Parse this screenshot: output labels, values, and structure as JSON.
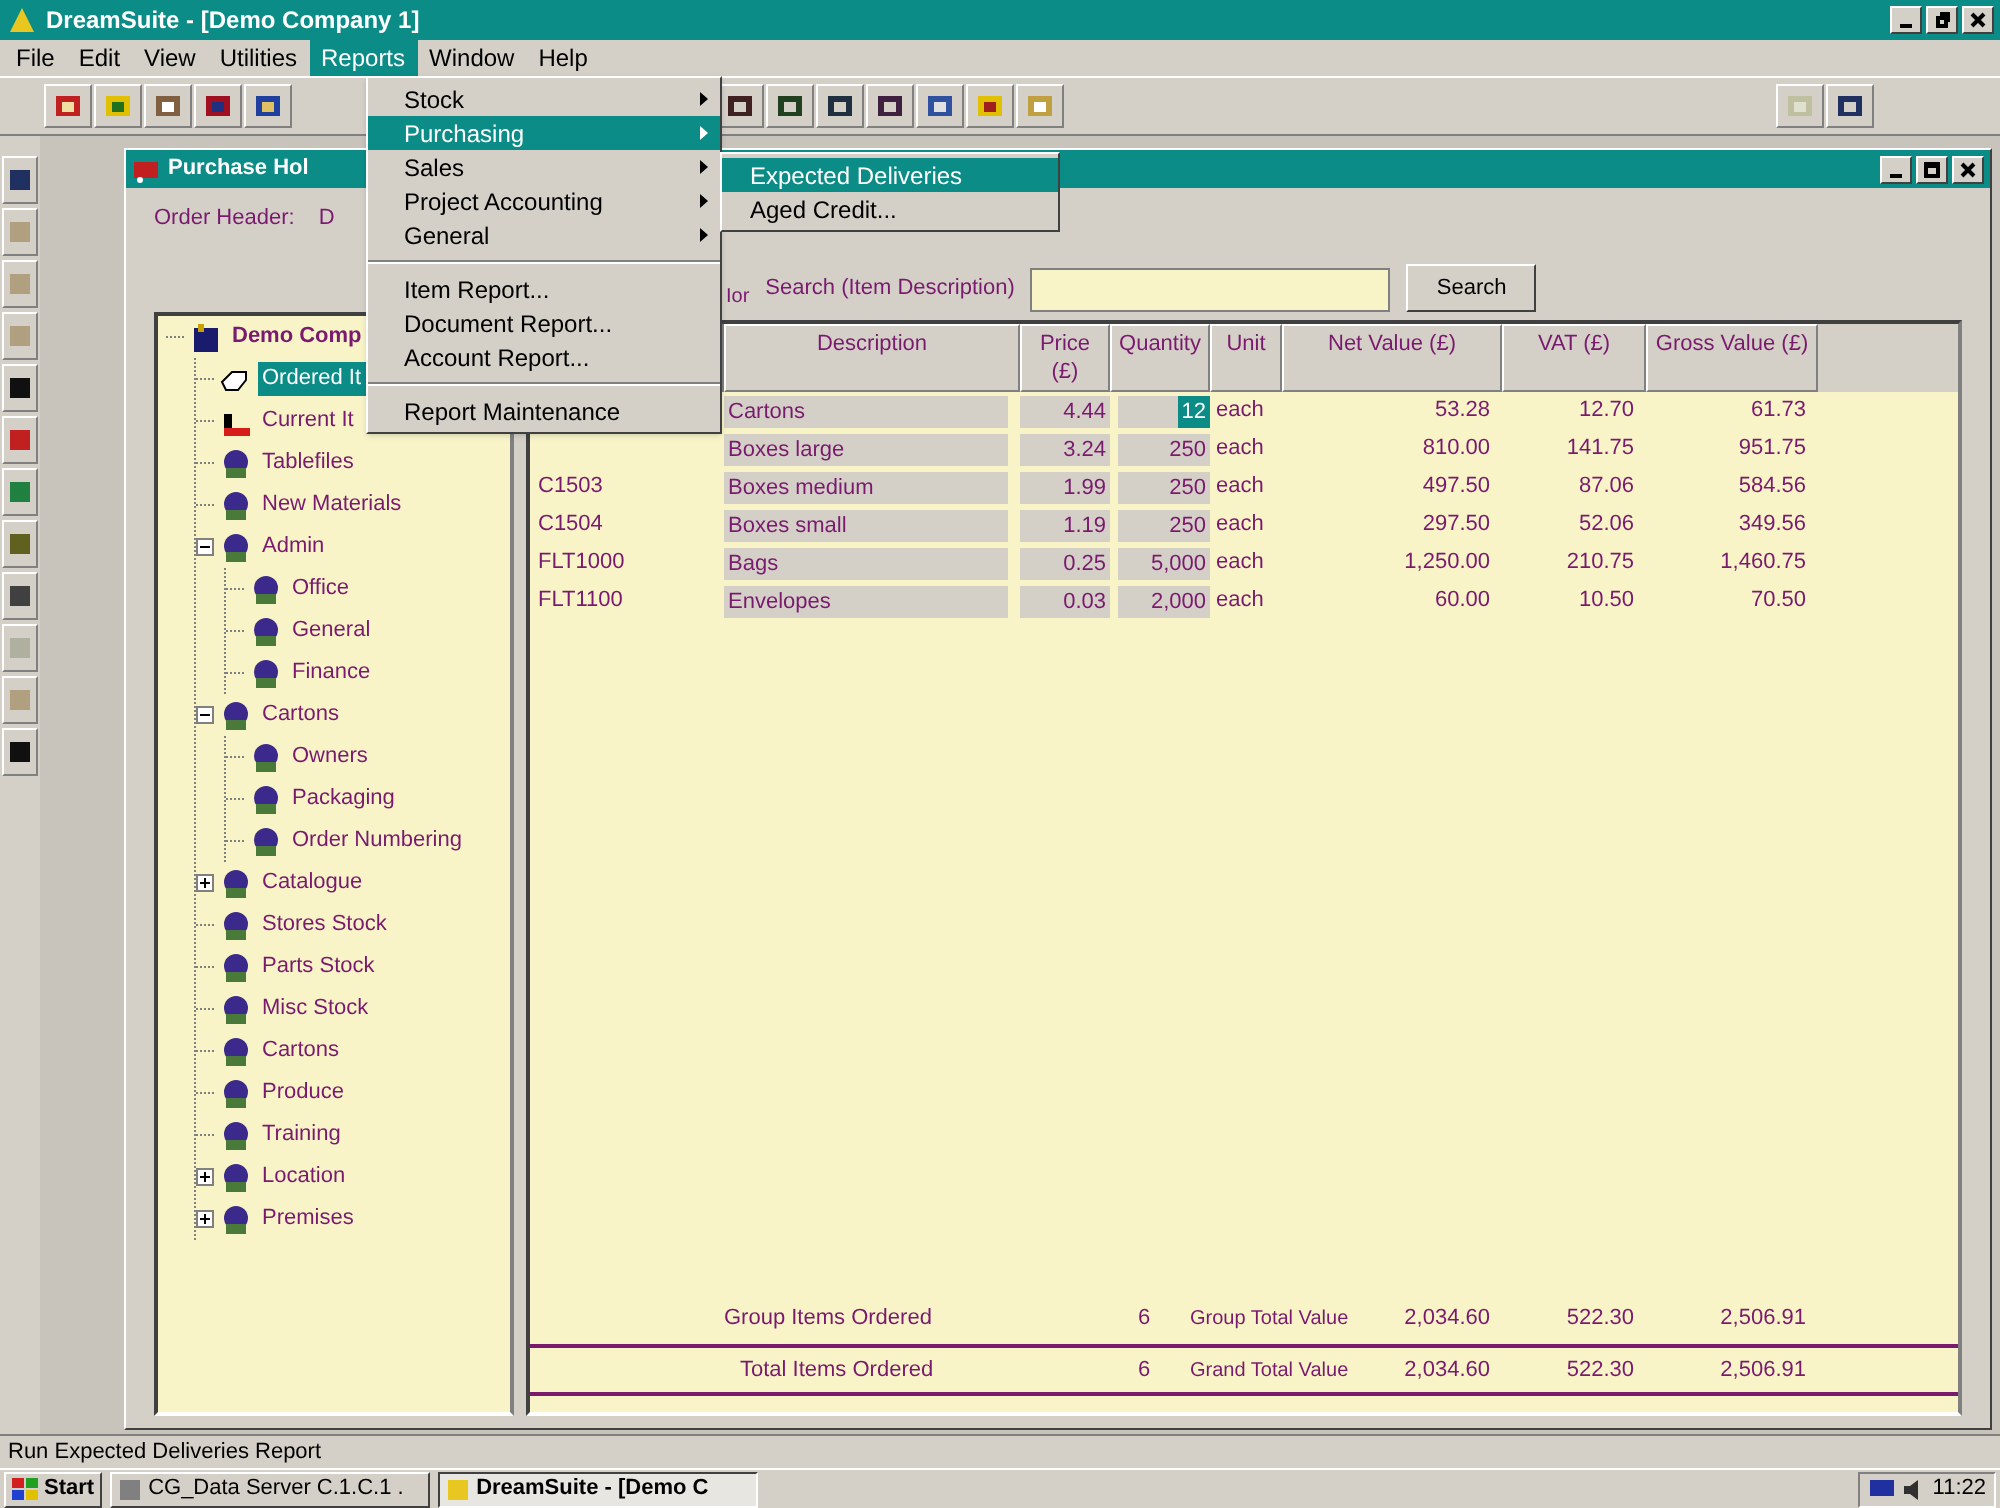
{
  "window": {
    "title": "DreamSuite - [Demo Company 1]"
  },
  "menu_bar": [
    {
      "label": "File",
      "selected": false
    },
    {
      "label": "Edit",
      "selected": false
    },
    {
      "label": "View",
      "selected": false
    },
    {
      "label": "Utilities",
      "selected": false
    },
    {
      "label": "Reports",
      "selected": true
    },
    {
      "label": "Window",
      "selected": false
    },
    {
      "label": "Help",
      "selected": false
    }
  ],
  "reports_menu": [
    {
      "kind": "submenu",
      "label": "Stock",
      "selected": false
    },
    {
      "kind": "submenu",
      "label": "Purchasing",
      "selected": true
    },
    {
      "kind": "submenu",
      "label": "Sales",
      "selected": false
    },
    {
      "kind": "submenu",
      "label": "Project Accounting",
      "selected": false
    },
    {
      "kind": "submenu",
      "label": "General",
      "selected": false
    },
    {
      "kind": "separator"
    },
    {
      "kind": "item",
      "label": "Item Report...",
      "selected": false
    },
    {
      "kind": "item",
      "label": "Document Report...",
      "selected": false
    },
    {
      "kind": "item",
      "label": "Account Report...",
      "selected": false
    },
    {
      "kind": "separator"
    },
    {
      "kind": "item",
      "label": "Report Maintenance",
      "selected": false
    }
  ],
  "purchasing_submenu": [
    {
      "label": "Expected Deliveries",
      "selected": true
    },
    {
      "label": "Aged Credit...",
      "selected": false
    }
  ],
  "child_window": {
    "title": "Purchase Hol",
    "order_header_label": "Order Header:",
    "order_header_value": "D"
  },
  "tree": [
    {
      "label": "Demo Comp",
      "kind": "company",
      "selected": false,
      "children": [
        {
          "label": "Ordered It",
          "kind": "ordered",
          "selected": true
        },
        {
          "label": "Current It",
          "kind": "current",
          "selected": false
        },
        {
          "label": "Tablefiles",
          "kind": "group",
          "selected": false
        },
        {
          "label": "New Materials",
          "kind": "group",
          "selected": false
        },
        {
          "label": "Admin",
          "kind": "group",
          "selected": false,
          "expanded": true,
          "children": [
            {
              "label": "Office",
              "kind": "group",
              "selected": false
            },
            {
              "label": "General",
              "kind": "group",
              "selected": false
            },
            {
              "label": "Finance",
              "kind": "group",
              "selected": false
            }
          ]
        },
        {
          "label": "Cartons",
          "kind": "group",
          "selected": false,
          "expanded": true,
          "children": [
            {
              "label": "Owners",
              "kind": "group",
              "selected": false
            },
            {
              "label": "Packaging",
              "kind": "group",
              "selected": false
            },
            {
              "label": "Order Numbering",
              "kind": "group",
              "selected": false
            }
          ]
        },
        {
          "label": "Catalogue",
          "kind": "group",
          "selected": false,
          "expanded": false
        },
        {
          "label": "Stores Stock",
          "kind": "group",
          "selected": false
        },
        {
          "label": "Parts Stock",
          "kind": "group",
          "selected": false
        },
        {
          "label": "Misc Stock",
          "kind": "group",
          "selected": false
        },
        {
          "label": "Cartons",
          "kind": "group",
          "selected": false
        },
        {
          "label": "Produce",
          "kind": "group",
          "selected": false
        },
        {
          "label": "Training",
          "kind": "group",
          "selected": false
        },
        {
          "label": "Location",
          "kind": "group",
          "selected": false,
          "expanded": false
        },
        {
          "label": "Premises",
          "kind": "group",
          "selected": false,
          "expanded": false
        }
      ]
    }
  ],
  "search": {
    "fragment": "Ior",
    "label": "Search (Item Description)",
    "button": "Search"
  },
  "table": {
    "columns": [
      "Description",
      "Price (£)",
      "Quantity",
      "Unit",
      "Net Value (£)",
      "VAT (£)",
      "Gross Value (£)"
    ],
    "rows": [
      {
        "code": "",
        "description": "Cartons",
        "price": "4.44",
        "quantity": "12",
        "quantity_selected": true,
        "unit": "each",
        "net": "53.28",
        "vat": "12.70",
        "gross": "61.73"
      },
      {
        "code": "",
        "description": "Boxes large",
        "price": "3.24",
        "quantity": "250",
        "quantity_selected": false,
        "unit": "each",
        "net": "810.00",
        "vat": "141.75",
        "gross": "951.75"
      },
      {
        "code": "C1503",
        "description": "Boxes medium",
        "price": "1.99",
        "quantity": "250",
        "quantity_selected": false,
        "unit": "each",
        "net": "497.50",
        "vat": "87.06",
        "gross": "584.56"
      },
      {
        "code": "C1504",
        "description": "Boxes small",
        "price": "1.19",
        "quantity": "250",
        "quantity_selected": false,
        "unit": "each",
        "net": "297.50",
        "vat": "52.06",
        "gross": "349.56"
      },
      {
        "code": "FLT1000",
        "description": "Bags",
        "price": "0.25",
        "quantity": "5,000",
        "quantity_selected": false,
        "unit": "each",
        "net": "1,250.00",
        "vat": "210.75",
        "gross": "1,460.75"
      },
      {
        "code": "FLT1100",
        "description": "Envelopes",
        "price": "0.03",
        "quantity": "2,000",
        "quantity_selected": false,
        "unit": "each",
        "net": "60.00",
        "vat": "10.50",
        "gross": "70.50"
      }
    ],
    "totals": [
      {
        "label": "Group Items Ordered",
        "count": "6",
        "value_label": "Group Total Value",
        "net": "2,034.60",
        "vat": "522.30",
        "gross": "2,506.91"
      },
      {
        "label": "Total Items Ordered",
        "count": "6",
        "value_label": "Grand Total Value",
        "net": "2,034.60",
        "vat": "522.30",
        "gross": "2,506.91"
      }
    ]
  },
  "status_bar": "Run Expected Deliveries Report",
  "taskbar": {
    "start": "Start",
    "tasks": [
      {
        "label": "CG_Data Server C.1.C.1 .",
        "selected": false
      },
      {
        "label": "DreamSuite - [Demo C",
        "selected": true
      }
    ],
    "clock": "11:22"
  }
}
